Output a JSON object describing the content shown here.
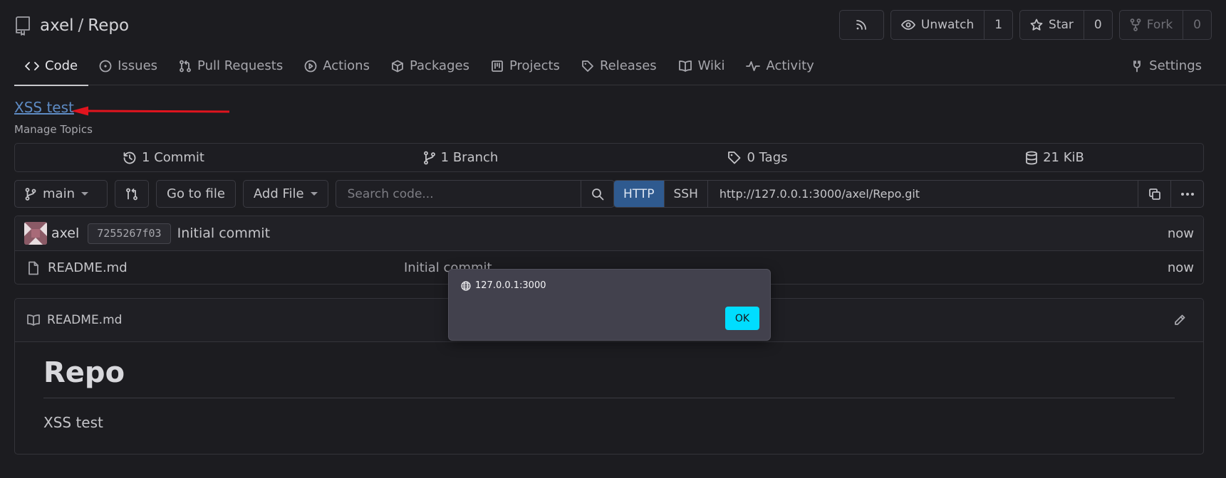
{
  "header": {
    "owner": "axel",
    "separator": "/",
    "repo": "Repo",
    "buttons": {
      "unwatch_label": "Unwatch",
      "unwatch_count": "1",
      "star_label": "Star",
      "star_count": "0",
      "fork_label": "Fork",
      "fork_count": "0"
    }
  },
  "tabs": [
    {
      "label": "Code",
      "icon": "code-icon",
      "active": true
    },
    {
      "label": "Issues",
      "icon": "issue-icon"
    },
    {
      "label": "Pull Requests",
      "icon": "pull-request-icon"
    },
    {
      "label": "Actions",
      "icon": "play-icon"
    },
    {
      "label": "Packages",
      "icon": "package-icon"
    },
    {
      "label": "Projects",
      "icon": "project-icon"
    },
    {
      "label": "Releases",
      "icon": "tag-icon"
    },
    {
      "label": "Wiki",
      "icon": "book-icon"
    },
    {
      "label": "Activity",
      "icon": "pulse-icon"
    },
    {
      "label": "Settings",
      "icon": "tools-icon"
    }
  ],
  "description": {
    "link_text": "XSS test",
    "manage_topics": "Manage Topics"
  },
  "stats": {
    "commits": "1 Commit",
    "branches": "1 Branch",
    "tags": "0 Tags",
    "size": "21 KiB"
  },
  "toolbar": {
    "branch": "main",
    "go_to_file": "Go to file",
    "add_file": "Add File",
    "search_placeholder": "Search code..."
  },
  "clone": {
    "http_label": "HTTP",
    "ssh_label": "SSH",
    "url": "http://127.0.0.1:3000/axel/Repo.git"
  },
  "latest_commit": {
    "author": "axel",
    "sha": "7255267f03",
    "message": "Initial commit",
    "time": "now"
  },
  "files": [
    {
      "name": "README.md",
      "commit": "Initial commit",
      "time": "now"
    }
  ],
  "readme": {
    "filename": "README.md",
    "heading": "Repo",
    "body": "XSS test"
  },
  "alert": {
    "origin": "127.0.0.1:3000",
    "ok_label": "OK"
  },
  "colors": {
    "background": "#1c1c20",
    "link": "#5e8bc4",
    "active_protocol": "#2f5a8f",
    "alert_ok": "#00ddff",
    "annotation_arrow": "#e0141e"
  }
}
